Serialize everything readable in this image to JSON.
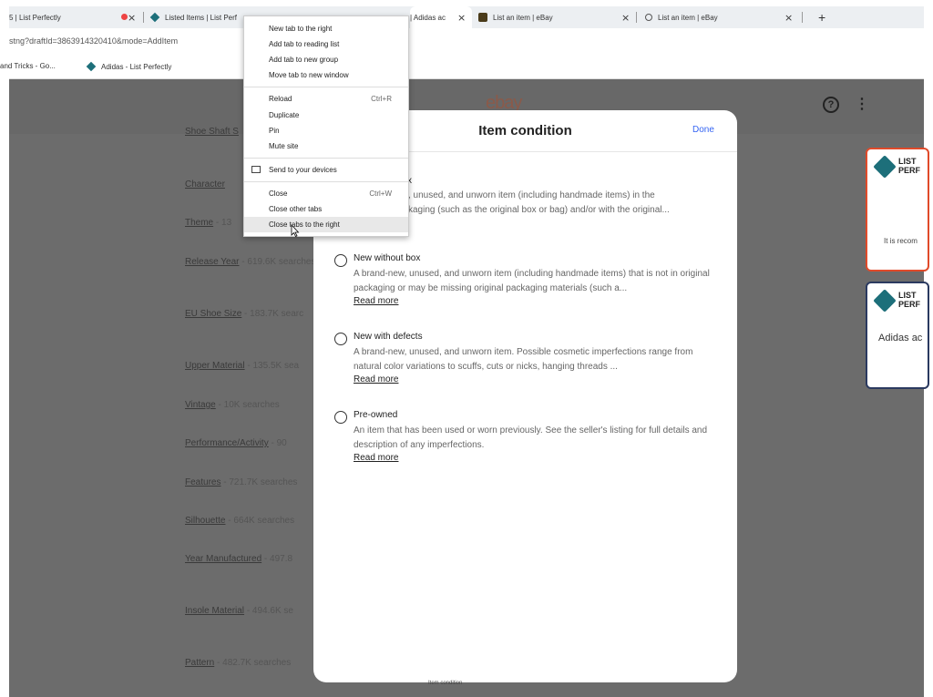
{
  "tabs": [
    {
      "title": "5 | List Perfectly",
      "close": "×"
    },
    {
      "title": "Listed Items | List Perf",
      "close": "×"
    },
    {
      "title": "| Adidas ac",
      "close": "×"
    },
    {
      "title": "List an item | eBay",
      "close": "×"
    },
    {
      "title": "List an item | eBay",
      "close": "×"
    }
  ],
  "new_tab": "+",
  "address": {
    "url": "stng?draftId=3863914320410&mode=AddItem"
  },
  "bookmarks": [
    {
      "label": "and Tricks - Go..."
    },
    {
      "label": "Adidas - List Perfectly"
    }
  ],
  "header": {
    "logo": "ebay",
    "help": "?",
    "more": "⋮"
  },
  "aspects": [
    {
      "name": "Shoe Shaft S",
      "stat": ""
    },
    {
      "name": "Character",
      "stat": ""
    },
    {
      "name": "Theme",
      "stat": "- 13"
    },
    {
      "name": "Release Year",
      "stat": "- 619.6K searches"
    },
    {
      "name": "EU Shoe Size",
      "stat": "- 183.7K searc"
    },
    {
      "name": "Upper Material",
      "stat": "- 135.5K sea"
    },
    {
      "name": "Vintage",
      "stat": "- 10K searches"
    },
    {
      "name": "Performance/Activity",
      "stat": "- 90"
    },
    {
      "name": "Features",
      "stat": "- 721.7K searches"
    },
    {
      "name": "Silhouette",
      "stat": "- 664K searches"
    },
    {
      "name": "Year Manufactured",
      "stat": "- 497.8"
    },
    {
      "name": "Insole Material",
      "stat": "- 494.6K se"
    },
    {
      "name": "Pattern",
      "stat": "- 482.7K searches"
    }
  ],
  "side_cards": [
    {
      "brand_line1": "LIST",
      "brand_line2": "PERF",
      "text": "It is recom"
    },
    {
      "brand_line1": "LIST",
      "brand_line2": "PERF",
      "text": "Adidas ac"
    }
  ],
  "modal": {
    "title": "Item condition",
    "done": "Done",
    "partial_option": {
      "label": "x",
      "desc_line1": ", unused, and unworn item (including handmade items) in the",
      "desc_line2": "kaging (such as the original box or bag) and/or with the original..."
    },
    "options": [
      {
        "label": "New without box",
        "desc": "A brand-new, unused, and unworn item (including handmade items) that is not in original packaging or may be missing original packaging materials (such a...",
        "read_more": "Read more"
      },
      {
        "label": "New with defects",
        "desc": "A brand-new, unused, and unworn item. Possible cosmetic imperfections range from natural color variations to scuffs, cuts or nicks, hanging threads ...",
        "read_more": "Read more"
      },
      {
        "label": "Pre-owned",
        "desc": "An item that has been used or worn previously. See the seller's listing for full details and description of any imperfections.",
        "read_more": "Read more"
      }
    ],
    "footer": "Item condition"
  },
  "context_menu": {
    "items": [
      {
        "label": "New tab to the right",
        "shortcut": ""
      },
      {
        "label": "Add tab to reading list",
        "shortcut": ""
      },
      {
        "label": "Add tab to new group",
        "shortcut": ""
      },
      {
        "label": "Move tab to new window",
        "shortcut": ""
      },
      {
        "label": "Reload",
        "shortcut": "Ctrl+R"
      },
      {
        "label": "Duplicate",
        "shortcut": ""
      },
      {
        "label": "Pin",
        "shortcut": ""
      },
      {
        "label": "Mute site",
        "shortcut": ""
      },
      {
        "label": "Send to your devices",
        "shortcut": ""
      },
      {
        "label": "Close",
        "shortcut": "Ctrl+W"
      },
      {
        "label": "Close other tabs",
        "shortcut": ""
      },
      {
        "label": "Close tabs to the right",
        "shortcut": ""
      }
    ]
  },
  "colors": {
    "accent_link": "#3665f3",
    "lp_brand": "#1d6f7a",
    "card_alert_border": "#e04a2a"
  }
}
